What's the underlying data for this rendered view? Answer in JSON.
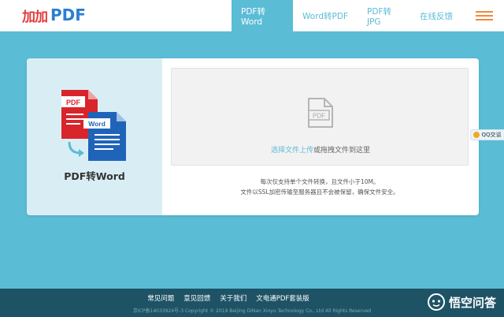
{
  "header": {
    "logo_mark": "加加",
    "logo_pdf": "PDF",
    "nav": [
      "PDF转Word",
      "Word转PDF",
      "PDF转JPG",
      "在线反馈"
    ]
  },
  "card": {
    "title": "PDF转Word",
    "icon_pdf_label": "PDF",
    "icon_word_label": "Word",
    "drop_icon_label": "PDF",
    "drop_link": "选择文件上传",
    "drop_text": "或拖拽文件到这里",
    "info_line1": "每次仅支持单个文件转换，且文件小于10M。",
    "info_line2": "文件以SSL加密传输至服务器且不会被保留，确保文件安全。"
  },
  "qq": {
    "label": "QQ交谈"
  },
  "footer": {
    "links": [
      "常见问题",
      "意见回馈",
      "关于我们",
      "文电通PDF套装版"
    ],
    "copyright": "京ICP备14033924号-3 Copyright © 2019 Beijing DiNan Xinyu Technology Co., Ltd All Rights Reserved",
    "watermark": "悟空问答"
  },
  "colors": {
    "accent": "#5bbcd6",
    "footer": "#1e5366",
    "pdf_red": "#d9242b",
    "word_blue": "#1f64b8",
    "menu_orange": "#f08a3c"
  }
}
